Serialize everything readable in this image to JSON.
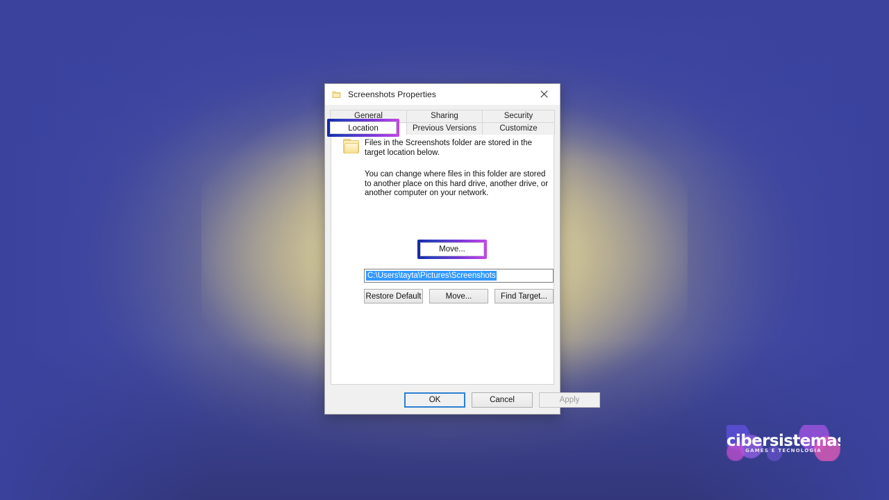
{
  "desktop": {
    "background_color": "#3d46a2",
    "glow_color": "#e9dd96"
  },
  "dialog": {
    "title": "Screenshots Properties",
    "title_icon": "folder-icon",
    "close_label": "✕",
    "tabs_row1": [
      {
        "label": "General",
        "active": false
      },
      {
        "label": "Sharing",
        "active": false
      },
      {
        "label": "Security",
        "active": false
      }
    ],
    "tabs_row2": [
      {
        "label": "Location",
        "active": true
      },
      {
        "label": "Previous Versions",
        "active": false
      },
      {
        "label": "Customize",
        "active": false
      }
    ],
    "body": {
      "folder_icon": "folder-icon",
      "paragraph_1": "Files in the Screenshots folder are stored in the target location below.",
      "paragraph_2": "You can change where files in this folder are stored to another place on this hard drive, another drive, or another computer on your network.",
      "path_value": "C:\\Users\\tayta\\Pictures\\Screenshots",
      "path_selected": true,
      "buttons": [
        {
          "id": "restore",
          "label": "Restore Default",
          "enabled": true
        },
        {
          "id": "move",
          "label": "Move...",
          "enabled": true,
          "highlighted": true
        },
        {
          "id": "find",
          "label": "Find Target...",
          "enabled": true
        }
      ]
    },
    "footer": {
      "ok_label": "OK",
      "cancel_label": "Cancel",
      "apply_label": "Apply",
      "apply_enabled": false,
      "ok_focused": true
    }
  },
  "annotations": {
    "highlight_color_start": "#1726a8",
    "highlight_color_end": "#c447e8",
    "highlighted_items": [
      "Location",
      "Move..."
    ]
  },
  "watermark": {
    "brand": "cibersistemas",
    "tagline": "GAMES E TECNOLOGIA"
  }
}
